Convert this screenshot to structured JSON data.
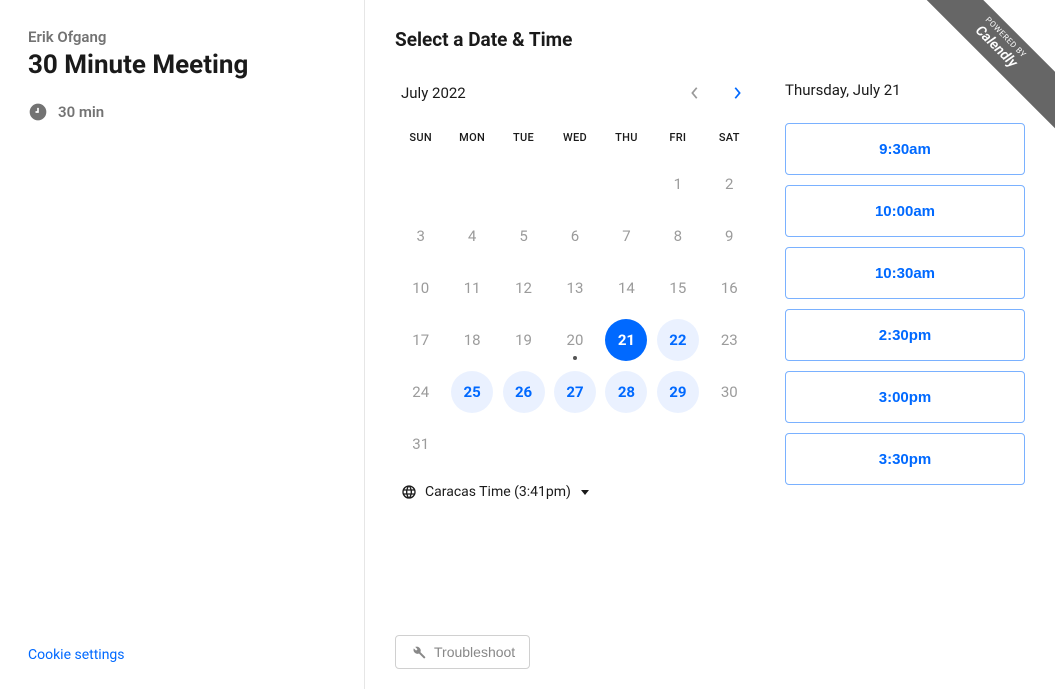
{
  "sidebar": {
    "host_name": "Erik Ofgang",
    "meeting_title": "30 Minute Meeting",
    "duration": "30 min",
    "cookie_settings": "Cookie settings"
  },
  "header": {
    "title": "Select a Date & Time"
  },
  "calendar": {
    "month_label": "July 2022",
    "dow": [
      "SUN",
      "MON",
      "TUE",
      "WED",
      "THU",
      "FRI",
      "SAT"
    ],
    "weeks": [
      [
        null,
        null,
        null,
        null,
        null,
        {
          "n": 1
        },
        {
          "n": 2
        }
      ],
      [
        {
          "n": 3
        },
        {
          "n": 4
        },
        {
          "n": 5
        },
        {
          "n": 6
        },
        {
          "n": 7
        },
        {
          "n": 8
        },
        {
          "n": 9
        }
      ],
      [
        {
          "n": 10
        },
        {
          "n": 11
        },
        {
          "n": 12
        },
        {
          "n": 13
        },
        {
          "n": 14
        },
        {
          "n": 15
        },
        {
          "n": 16
        }
      ],
      [
        {
          "n": 17
        },
        {
          "n": 18
        },
        {
          "n": 19
        },
        {
          "n": 20,
          "today": true
        },
        {
          "n": 21,
          "selected": true
        },
        {
          "n": 22,
          "available": true
        },
        {
          "n": 23
        }
      ],
      [
        {
          "n": 24
        },
        {
          "n": 25,
          "available": true
        },
        {
          "n": 26,
          "available": true
        },
        {
          "n": 27,
          "available": true
        },
        {
          "n": 28,
          "available": true
        },
        {
          "n": 29,
          "available": true
        },
        {
          "n": 30
        }
      ],
      [
        {
          "n": 31
        },
        null,
        null,
        null,
        null,
        null,
        null
      ]
    ],
    "timezone_label": "Caracas Time (3:41pm)"
  },
  "slots": {
    "date_label": "Thursday, July 21",
    "times": [
      "9:30am",
      "10:00am",
      "10:30am",
      "2:30pm",
      "3:00pm",
      "3:30pm"
    ]
  },
  "troubleshoot_label": "Troubleshoot",
  "badge": {
    "small": "POWERED BY",
    "brand": "Calendly"
  }
}
